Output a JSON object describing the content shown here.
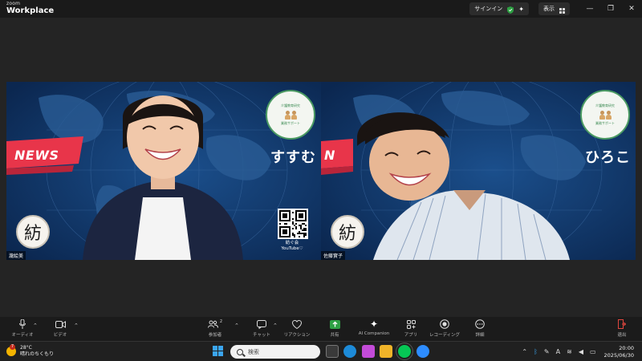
{
  "titlebar": {
    "brand_small": "zoom",
    "brand_main": "Workplace",
    "signin_label": "サインイン",
    "view_label": "表示"
  },
  "participants": [
    {
      "display_name": "すすむ",
      "name_label": "瀧絵美",
      "kanji_logo": "紡",
      "news_text": "NEWS",
      "emblem_top": "介護教育研究",
      "emblem_bottom": "業務サポート",
      "qr_caption_1": "紡ぐ会",
      "qr_caption_2": "YouTube♡"
    },
    {
      "display_name": "ひろこ",
      "name_label": "佐藤實子",
      "kanji_logo": "紡",
      "news_text": "N",
      "emblem_top": "介護教育研究",
      "emblem_bottom": "業務サポート"
    }
  ],
  "toolbar": {
    "audio": "オーディオ",
    "video": "ビデオ",
    "participants": "参加者",
    "participants_count": "2",
    "chat": "チャット",
    "reactions": "リアクション",
    "share": "共有",
    "ai": "AI Companion",
    "apps": "アプリ",
    "record": "レコーディング",
    "more": "詳細",
    "leave": "退出"
  },
  "taskbar": {
    "weather_badge": "7",
    "temperature": "28°C",
    "weather_desc": "晴れのちくもり",
    "search_placeholder": "検索",
    "time": "20:00",
    "date": "2025/06/30"
  },
  "colors": {
    "tile_bg": "#0f3566",
    "news_red": "#e8354a",
    "emblem_green": "#4a9a62",
    "share_green": "#2ea043"
  }
}
